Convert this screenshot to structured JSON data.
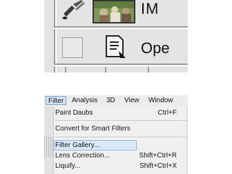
{
  "top_panel": {
    "labels": [
      "IM",
      "Ope"
    ],
    "icons": [
      "brush-icon",
      "thumbnail-image",
      "open-document-icon",
      "checkbox-square"
    ]
  },
  "menubar": {
    "items": [
      "Filter",
      "Analysis",
      "3D",
      "View",
      "Window"
    ]
  },
  "filter_menu": {
    "items": [
      {
        "label": "Paint Daubs",
        "shortcut": "Ctrl+F"
      },
      {
        "label": "Convert for Smart Filters",
        "shortcut": ""
      },
      {
        "label": "Filter Gallery...",
        "shortcut": ""
      },
      {
        "label": "Lens Correction...",
        "shortcut": "Shift+Ctrl+R"
      },
      {
        "label": "Liquify...",
        "shortcut": "Shift+Ctrl+X"
      }
    ],
    "highlighted": "Filter Gallery..."
  },
  "colors": {
    "highlight_fill": "#dbe8f8",
    "highlight_border": "#8fb2de",
    "menu_bg": "#f0f0f0"
  }
}
